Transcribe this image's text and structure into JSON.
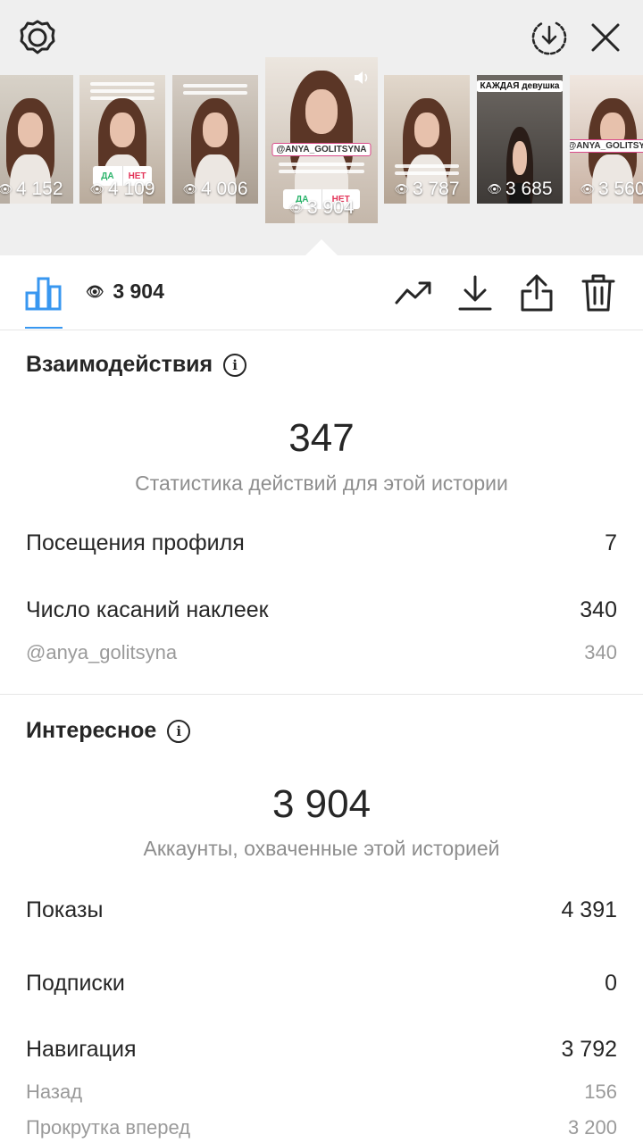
{
  "header": {
    "icons": [
      "settings-gear-icon",
      "download-circle-icon",
      "close-icon"
    ]
  },
  "stories": [
    {
      "views": "4 152"
    },
    {
      "views": "4 109",
      "poll_yes": "ДА",
      "poll_no": "НЕТ"
    },
    {
      "views": "4 006"
    },
    {
      "views": "3 904",
      "active": true,
      "mention": "@ANYA_GOLITSYNA",
      "poll_yes": "ДА",
      "poll_no": "НЕТ"
    },
    {
      "views": "3 787"
    },
    {
      "views": "3 685",
      "headline": "КАЖДАЯ девушка"
    },
    {
      "views": "3 560",
      "mention": "@ANYA_GOLITSYNA"
    }
  ],
  "toolbar": {
    "views": "3 904",
    "icons": [
      "bar-chart-icon",
      "eye-icon",
      "trend-up-icon",
      "download-icon",
      "share-icon",
      "trash-icon"
    ]
  },
  "interactions": {
    "title": "Взаимодействия",
    "total": "347",
    "caption": "Статистика действий для этой истории",
    "rows": [
      {
        "label": "Посещения профиля",
        "value": "7"
      },
      {
        "label": "Число касаний наклеек",
        "value": "340"
      }
    ],
    "sub_rows": [
      {
        "label": "@anya_golitsyna",
        "value": "340"
      }
    ]
  },
  "discovery": {
    "title": "Интересное",
    "total": "3 904",
    "caption": "Аккаунты, охваченные этой историей",
    "rows": [
      {
        "label": "Показы",
        "value": "4 391"
      },
      {
        "label": "Подписки",
        "value": "0"
      },
      {
        "label": "Навигация",
        "value": "3 792"
      }
    ],
    "sub_rows": [
      {
        "label": "Назад",
        "value": "156"
      },
      {
        "label": "Прокрутка вперед",
        "value": "3 200"
      }
    ]
  },
  "colors": {
    "accent": "#3897f0",
    "text": "#262626",
    "muted": "#8e8e8e",
    "strip_bg": "#efefef"
  }
}
